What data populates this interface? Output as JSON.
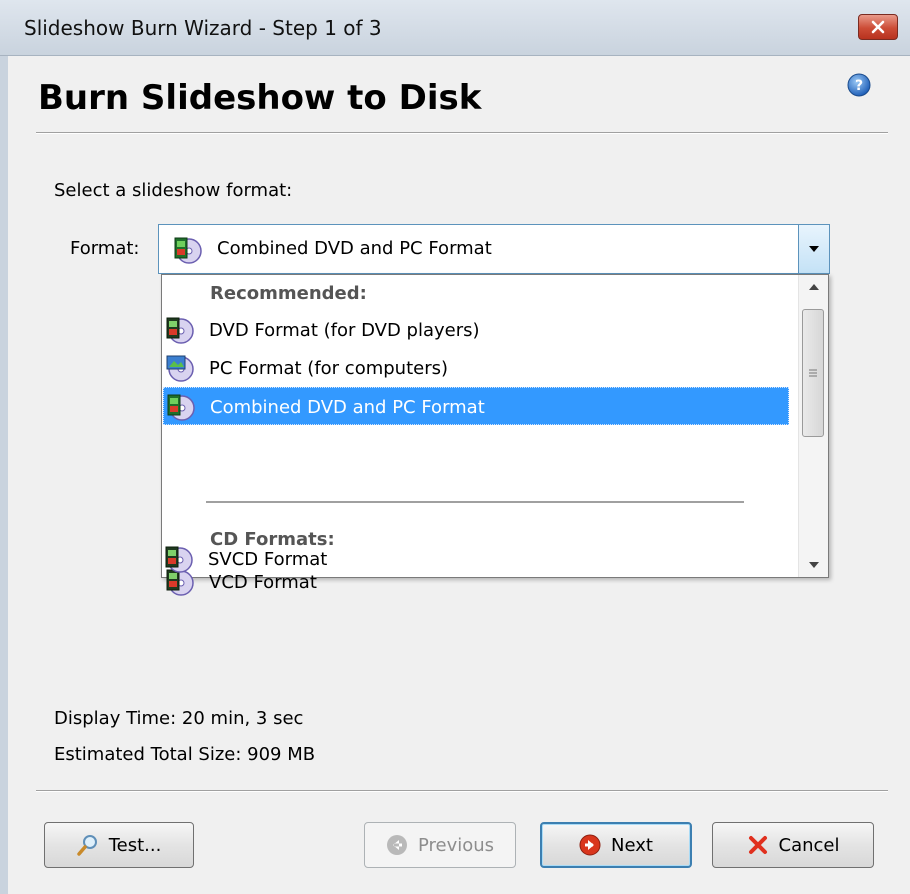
{
  "window": {
    "title": "Slideshow Burn Wizard - Step 1 of 3",
    "close_icon": "close-icon"
  },
  "header": {
    "heading": "Burn Slideshow to Disk",
    "help_icon": "help-icon"
  },
  "form": {
    "select_prompt": "Select a slideshow format:",
    "format_label": "Format:",
    "format_value": "Combined DVD and PC Format"
  },
  "dropdown": {
    "groups": [
      {
        "heading": "Recommended:"
      },
      {
        "heading": "CD Formats:"
      }
    ],
    "options": [
      {
        "label": "DVD Format (for DVD players)",
        "icon": "dvd-disc-icon"
      },
      {
        "label": "PC Format (for computers)",
        "icon": "pc-disc-icon"
      },
      {
        "label": "Combined DVD and PC Format",
        "icon": "combined-disc-icon",
        "selected": true
      },
      {
        "label": "VCD Format",
        "icon": "vcd-disc-icon"
      },
      {
        "label": "SVCD Format",
        "icon": "svcd-disc-icon"
      }
    ]
  },
  "info": {
    "display_time": "Display Time: 20 min, 3 sec",
    "estimated_size": "Estimated Total Size: 909 MB"
  },
  "buttons": {
    "test": "Test...",
    "previous": "Previous",
    "next": "Next",
    "cancel": "Cancel"
  },
  "colors": {
    "selection": "#3399ff",
    "title_close": "#cc4c36",
    "next_icon": "#d9361d",
    "cancel_icon": "#e0301e"
  }
}
